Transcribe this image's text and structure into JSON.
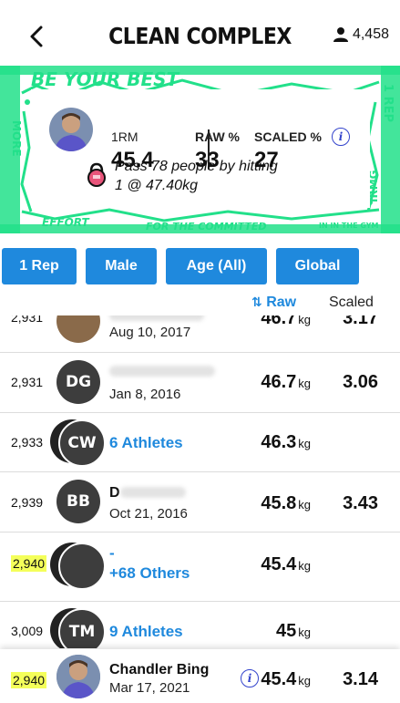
{
  "header": {
    "title": "CLEAN COMPLEX",
    "user_count": "4,458"
  },
  "banner": {
    "texts": [
      "BE YOUR BEST",
      "EFFORT",
      "FOR THE COMMITTED",
      "1 REP",
      "IRMG",
      "MORE",
      "IN IN THE GYM"
    ],
    "accent_color": "#22e08a"
  },
  "my_stats": {
    "one_rm_label": "1RM",
    "one_rm_value": "45.4",
    "raw_label": "RAW %",
    "raw_value": "33",
    "scaled_label": "SCALED %",
    "scaled_value": "27",
    "pass_line1": "Pass 78 people by hitting",
    "pass_line2": "1 @ 47.40kg"
  },
  "filters": [
    "1 Rep",
    "Male",
    "Age (All)",
    "Global"
  ],
  "columns": {
    "raw": "Raw",
    "scaled": "Scaled"
  },
  "rows": [
    {
      "rank": "2,931",
      "date": "Aug 10, 2017",
      "raw": "46.7",
      "unit": "kg",
      "scaled": "3.17"
    },
    {
      "rank": "2,931",
      "initials": "DG",
      "date": "Jan 8, 2016",
      "raw": "46.7",
      "unit": "kg",
      "scaled": "3.06"
    },
    {
      "rank": "2,933",
      "initials": "CW",
      "link": "6 Athletes",
      "raw": "46.3",
      "unit": "kg"
    },
    {
      "rank": "2,939",
      "initials": "BB",
      "name": "D",
      "date": "Oct 21, 2016",
      "raw": "45.8",
      "unit": "kg",
      "scaled": "3.43"
    },
    {
      "rank": "2,940",
      "link_line1": "-",
      "link_line2": "+68 Others",
      "raw": "45.4",
      "unit": "kg"
    },
    {
      "rank": "3,009",
      "initials": "TM",
      "link": "9 Athletes",
      "raw": "45",
      "unit": "kg"
    }
  ],
  "me": {
    "rank": "2,940",
    "name": "Chandler Bing",
    "date": "Mar 17, 2021",
    "raw": "45.4",
    "unit": "kg",
    "scaled": "3.14"
  }
}
